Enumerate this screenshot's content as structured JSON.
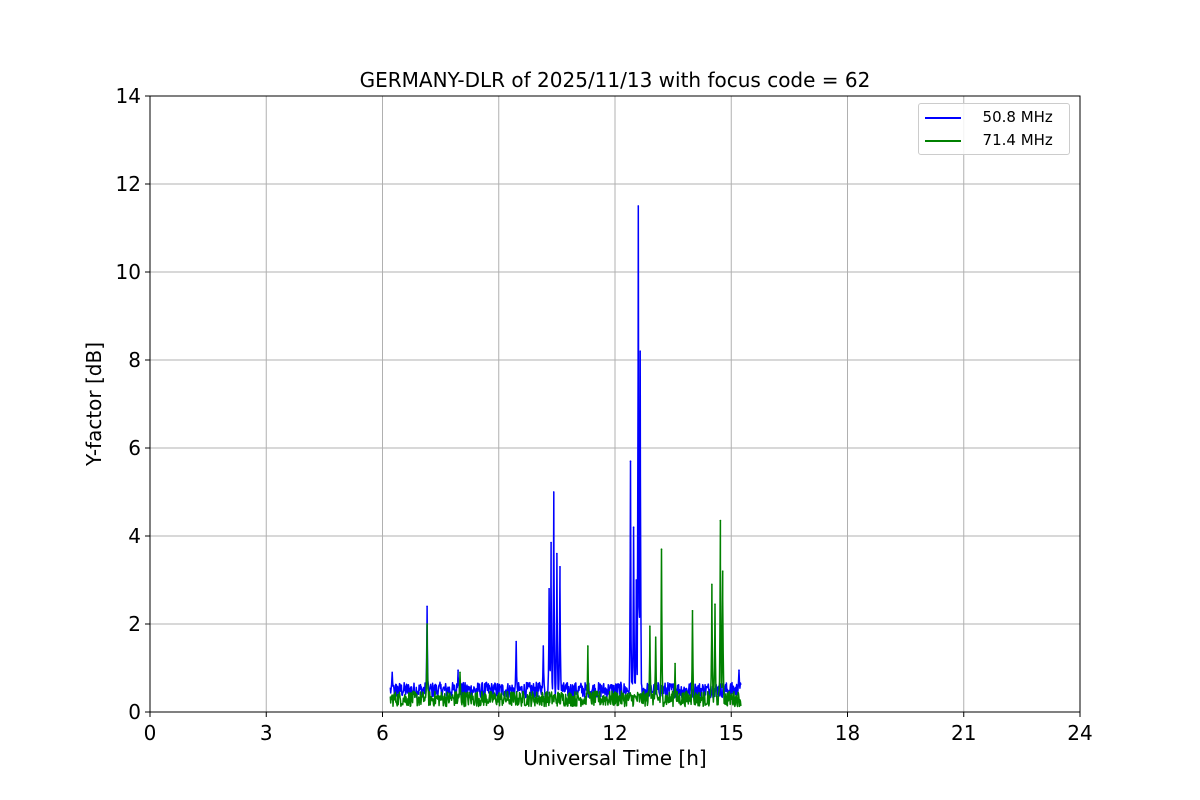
{
  "chart_data": {
    "type": "line",
    "title": "GERMANY-DLR of 2025/11/13 with focus code = 62",
    "xlabel": "Universal Time [h]",
    "ylabel": "Y-factor [dB]",
    "xlim": [
      0,
      24
    ],
    "ylim": [
      0,
      14
    ],
    "xticks": [
      "0",
      "3",
      "6",
      "9",
      "12",
      "15",
      "18",
      "21",
      "24"
    ],
    "yticks": [
      "0",
      "2",
      "4",
      "6",
      "8",
      "10",
      "12",
      "14"
    ],
    "grid": true,
    "legend_position": "top-right",
    "series": [
      {
        "name": "  50.8 MHz",
        "color": "#0000ff",
        "peaks": [
          {
            "x": 6.25,
            "y": 0.9
          },
          {
            "x": 7.15,
            "y": 2.4
          },
          {
            "x": 7.95,
            "y": 0.95
          },
          {
            "x": 9.45,
            "y": 1.6
          },
          {
            "x": 10.15,
            "y": 1.5
          },
          {
            "x": 10.3,
            "y": 2.8
          },
          {
            "x": 10.35,
            "y": 3.85
          },
          {
            "x": 10.42,
            "y": 5.0
          },
          {
            "x": 10.5,
            "y": 3.6
          },
          {
            "x": 10.58,
            "y": 3.3
          },
          {
            "x": 12.4,
            "y": 5.7
          },
          {
            "x": 12.48,
            "y": 4.2
          },
          {
            "x": 12.55,
            "y": 3.0
          },
          {
            "x": 12.6,
            "y": 11.5
          },
          {
            "x": 12.65,
            "y": 8.2
          },
          {
            "x": 15.2,
            "y": 0.95
          }
        ],
        "baseline": 0.5,
        "x_range": [
          6.2,
          15.25
        ]
      },
      {
        "name": "  71.4 MHz",
        "color": "#008000",
        "peaks": [
          {
            "x": 7.15,
            "y": 2.0
          },
          {
            "x": 8.0,
            "y": 0.9
          },
          {
            "x": 11.3,
            "y": 1.5
          },
          {
            "x": 12.9,
            "y": 1.95
          },
          {
            "x": 13.05,
            "y": 1.7
          },
          {
            "x": 13.2,
            "y": 3.7
          },
          {
            "x": 13.55,
            "y": 1.1
          },
          {
            "x": 14.0,
            "y": 2.3
          },
          {
            "x": 14.5,
            "y": 2.9
          },
          {
            "x": 14.58,
            "y": 2.45
          },
          {
            "x": 14.72,
            "y": 4.35
          },
          {
            "x": 14.78,
            "y": 3.2
          }
        ],
        "baseline": 0.3,
        "x_range": [
          6.2,
          15.25
        ]
      }
    ]
  }
}
